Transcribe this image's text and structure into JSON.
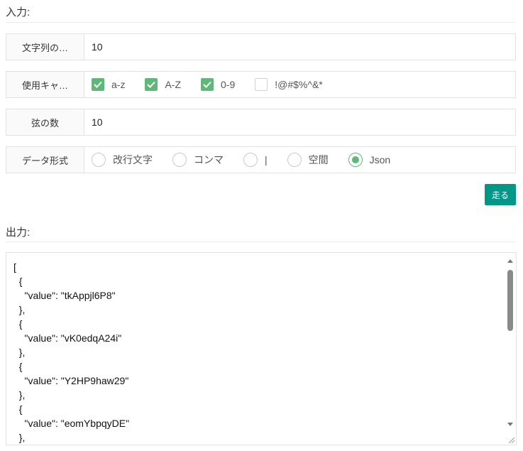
{
  "input_section": {
    "title": "入力:"
  },
  "fields": {
    "length": {
      "label": "文字列の…",
      "value": "10"
    },
    "charset": {
      "label": "使用キャ…",
      "options": [
        {
          "label": "a-z",
          "checked": true
        },
        {
          "label": "A-Z",
          "checked": true
        },
        {
          "label": "0-9",
          "checked": true
        },
        {
          "label": "!@#$%^&*",
          "checked": false
        }
      ]
    },
    "count": {
      "label": "弦の数",
      "value": "10"
    },
    "format": {
      "label": "データ形式",
      "options": [
        {
          "label": "改行文字",
          "selected": false
        },
        {
          "label": "コンマ",
          "selected": false
        },
        {
          "label": "|",
          "selected": false
        },
        {
          "label": "空間",
          "selected": false
        },
        {
          "label": "Json",
          "selected": true
        }
      ]
    }
  },
  "run_button": {
    "label": "走る"
  },
  "output_section": {
    "title": "出力:",
    "text": "[\n  {\n    \"value\": \"tkAppjl6P8\"\n  },\n  {\n    \"value\": \"vK0edqA24i\"\n  },\n  {\n    \"value\": \"Y2HP9haw29\"\n  },\n  {\n    \"value\": \"eomYbpqyDE\"\n  },"
  },
  "colors": {
    "accent": "#009688",
    "check": "#5fb878"
  }
}
